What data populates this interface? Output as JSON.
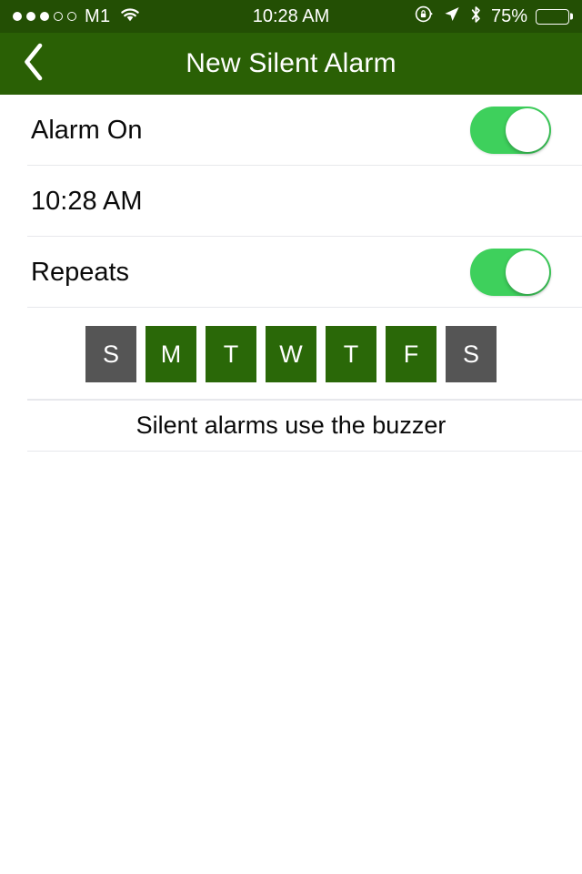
{
  "status_bar": {
    "signal_dots_filled": 3,
    "signal_dots_total": 5,
    "carrier": "M1",
    "wifi_icon": "wifi-icon",
    "time": "10:28 AM",
    "rotation_lock_icon": "rotation-lock-icon",
    "location_icon": "location-arrow-icon",
    "bluetooth_icon": "bluetooth-icon",
    "battery_percent": "75%",
    "battery_level": 75,
    "background_color": "#234f04",
    "text_color": "#ffffff"
  },
  "nav_bar": {
    "back_icon": "chevron-left-icon",
    "title": "New Silent Alarm",
    "background_color": "#2a6005",
    "text_color": "#ffffff"
  },
  "rows": {
    "alarm_on": {
      "label": "Alarm On",
      "toggle_state": "on"
    },
    "time": {
      "value": "10:28 AM"
    },
    "repeats": {
      "label": "Repeats",
      "toggle_state": "on"
    }
  },
  "day_selector": {
    "days": [
      {
        "label": "S",
        "name": "sunday",
        "selected": false
      },
      {
        "label": "M",
        "name": "monday",
        "selected": true
      },
      {
        "label": "T",
        "name": "tuesday",
        "selected": true
      },
      {
        "label": "W",
        "name": "wednesday",
        "selected": true
      },
      {
        "label": "T",
        "name": "thursday",
        "selected": true
      },
      {
        "label": "F",
        "name": "friday",
        "selected": true
      },
      {
        "label": "S",
        "name": "saturday",
        "selected": false
      }
    ],
    "selected_color": "#2a6808",
    "unselected_color": "#555555"
  },
  "footer": {
    "note": "Silent alarms use the buzzer"
  },
  "colors": {
    "toggle_on": "#3ed05c",
    "separator": "#e7e8ec",
    "background": "#ffffff"
  }
}
